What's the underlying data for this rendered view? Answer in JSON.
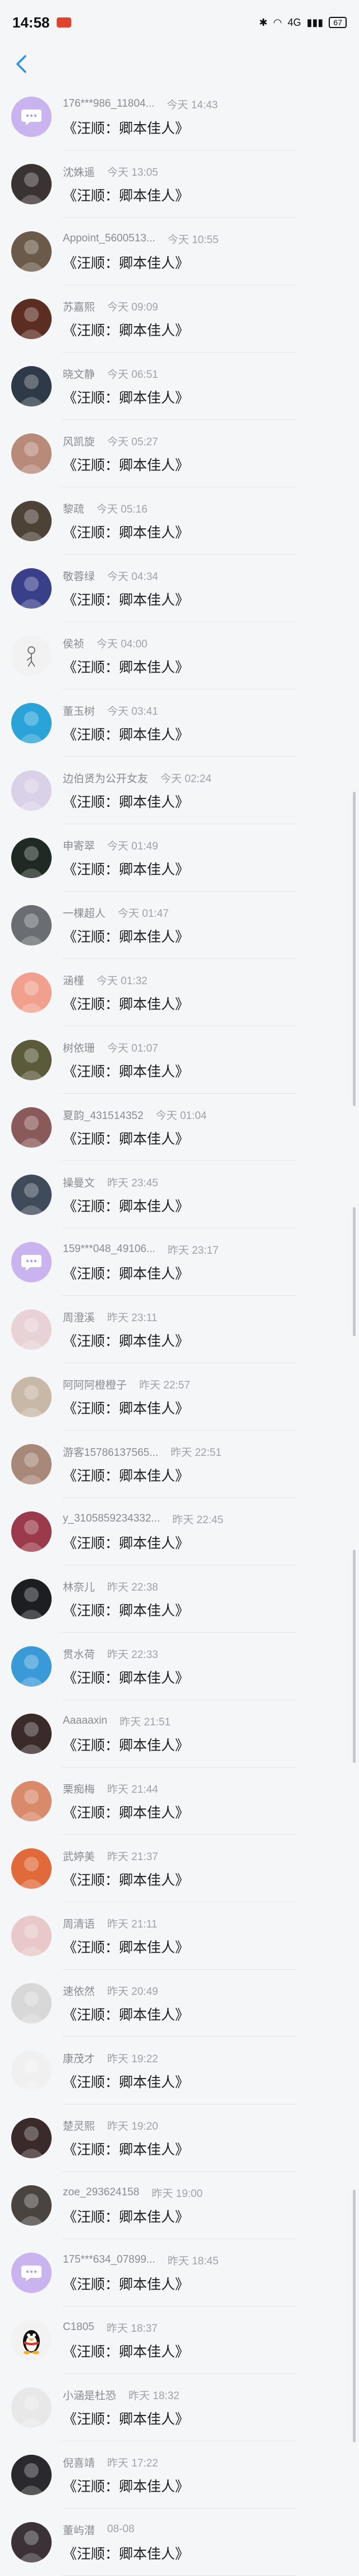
{
  "status_bar": {
    "time": "14:58",
    "signal_text": "4G",
    "battery": "67"
  },
  "message_text": "《汪顺：卿本佳人》",
  "rows": [
    {
      "name": "176***986_11804...",
      "time": "今天 14:43",
      "avatar_color": "#c9b4ef",
      "avatar_kind": "chat-bubble-icon"
    },
    {
      "name": "沈姝遥",
      "time": "今天 13:05",
      "avatar_color": "#3b3232",
      "avatar_kind": "photo"
    },
    {
      "name": "Appoint_5600513...",
      "time": "今天 10:55",
      "avatar_color": "#6b5a4a",
      "avatar_kind": "photo"
    },
    {
      "name": "苏嘉熙",
      "time": "今天 09:09",
      "avatar_color": "#5c2e22",
      "avatar_kind": "photo"
    },
    {
      "name": "晓文静",
      "time": "今天 06:51",
      "avatar_color": "#2e3a48",
      "avatar_kind": "photo"
    },
    {
      "name": "风凯旋",
      "time": "今天 05:27",
      "avatar_color": "#b88a7a",
      "avatar_kind": "photo"
    },
    {
      "name": "黎疏",
      "time": "今天 05:16",
      "avatar_color": "#4d4236",
      "avatar_kind": "photo"
    },
    {
      "name": "敬蓉绿",
      "time": "今天 04:34",
      "avatar_color": "#3a3f8a",
      "avatar_kind": "photo"
    },
    {
      "name": "侯祯",
      "time": "今天 04:00",
      "avatar_color": "#f2f2f2",
      "avatar_kind": "sketch"
    },
    {
      "name": "董玉树",
      "time": "今天 03:41",
      "avatar_color": "#2aa3d8",
      "avatar_kind": "photo"
    },
    {
      "name": "边伯贤为公开女友",
      "time": "今天 02:24",
      "avatar_color": "#d9d1e8",
      "avatar_kind": "photo"
    },
    {
      "name": "申寄翠",
      "time": "今天 01:49",
      "avatar_color": "#1f2a24",
      "avatar_kind": "photo"
    },
    {
      "name": "一棵超人",
      "time": "今天 01:47",
      "avatar_color": "#6a6e73",
      "avatar_kind": "photo"
    },
    {
      "name": "涵槿",
      "time": "今天 01:32",
      "avatar_color": "#f0a08c",
      "avatar_kind": "photo"
    },
    {
      "name": "树依珊",
      "time": "今天 01:07",
      "avatar_color": "#5b5a3a",
      "avatar_kind": "photo"
    },
    {
      "name": "夏韵_431514352",
      "time": "今天 01:04",
      "avatar_color": "#8a5a5a",
      "avatar_kind": "photo"
    },
    {
      "name": "操曼文",
      "time": "昨天 23:45",
      "avatar_color": "#3f4a5a",
      "avatar_kind": "photo"
    },
    {
      "name": "159***048_49106...",
      "time": "昨天 23:17",
      "avatar_color": "#c9b4ef",
      "avatar_kind": "chat-bubble-icon"
    },
    {
      "name": "周澄溪",
      "time": "昨天 23:11",
      "avatar_color": "#e8d2d6",
      "avatar_kind": "photo"
    },
    {
      "name": "阿阿阿橙橙子",
      "time": "昨天 22:57",
      "avatar_color": "#c8b8a8",
      "avatar_kind": "photo"
    },
    {
      "name": "游客15786137565...",
      "time": "昨天 22:51",
      "avatar_color": "#a88878",
      "avatar_kind": "photo"
    },
    {
      "name": "y_3105859234332...",
      "time": "昨天 22:45",
      "avatar_color": "#9a3a4a",
      "avatar_kind": "photo"
    },
    {
      "name": "林奈儿",
      "time": "昨天 22:38",
      "avatar_color": "#1c1e22",
      "avatar_kind": "photo"
    },
    {
      "name": "贯水荷",
      "time": "昨天 22:33",
      "avatar_color": "#3a9ad8",
      "avatar_kind": "photo"
    },
    {
      "name": "Aaaaaxin",
      "time": "昨天 21:51",
      "avatar_color": "#3a2a2a",
      "avatar_kind": "photo"
    },
    {
      "name": "栗痴梅",
      "time": "昨天 21:44",
      "avatar_color": "#d88a6a",
      "avatar_kind": "photo"
    },
    {
      "name": "武婷美",
      "time": "昨天 21:37",
      "avatar_color": "#e06a3a",
      "avatar_kind": "photo"
    },
    {
      "name": "周清语",
      "time": "昨天 21:11",
      "avatar_color": "#e8c8c8",
      "avatar_kind": "photo"
    },
    {
      "name": "速依然",
      "time": "昨天 20:49",
      "avatar_color": "#d8d8d8",
      "avatar_kind": "photo"
    },
    {
      "name": "康茂才",
      "time": "昨天 19:22",
      "avatar_color": "#f0f0f0",
      "avatar_kind": "photo"
    },
    {
      "name": "楚灵熙",
      "time": "昨天 19:20",
      "avatar_color": "#3a2a2a",
      "avatar_kind": "photo"
    },
    {
      "name": "zoe_293624158",
      "time": "昨天 19:00",
      "avatar_color": "#4a4440",
      "avatar_kind": "photo"
    },
    {
      "name": "175***634_07899...",
      "time": "昨天 18:45",
      "avatar_color": "#c9b4ef",
      "avatar_kind": "chat-bubble-icon"
    },
    {
      "name": "C1805",
      "time": "昨天 18:37",
      "avatar_color": "#f2f2f2",
      "avatar_kind": "penguin"
    },
    {
      "name": "小涵是杜恐",
      "time": "昨天 18:32",
      "avatar_color": "#e8e8e8",
      "avatar_kind": "photo"
    },
    {
      "name": "倪喜靖",
      "time": "昨天 17:22",
      "avatar_color": "#2a2a2e",
      "avatar_kind": "photo"
    },
    {
      "name": "董屿潜",
      "time": "08-08",
      "avatar_color": "#3a3236",
      "avatar_kind": "photo"
    }
  ]
}
